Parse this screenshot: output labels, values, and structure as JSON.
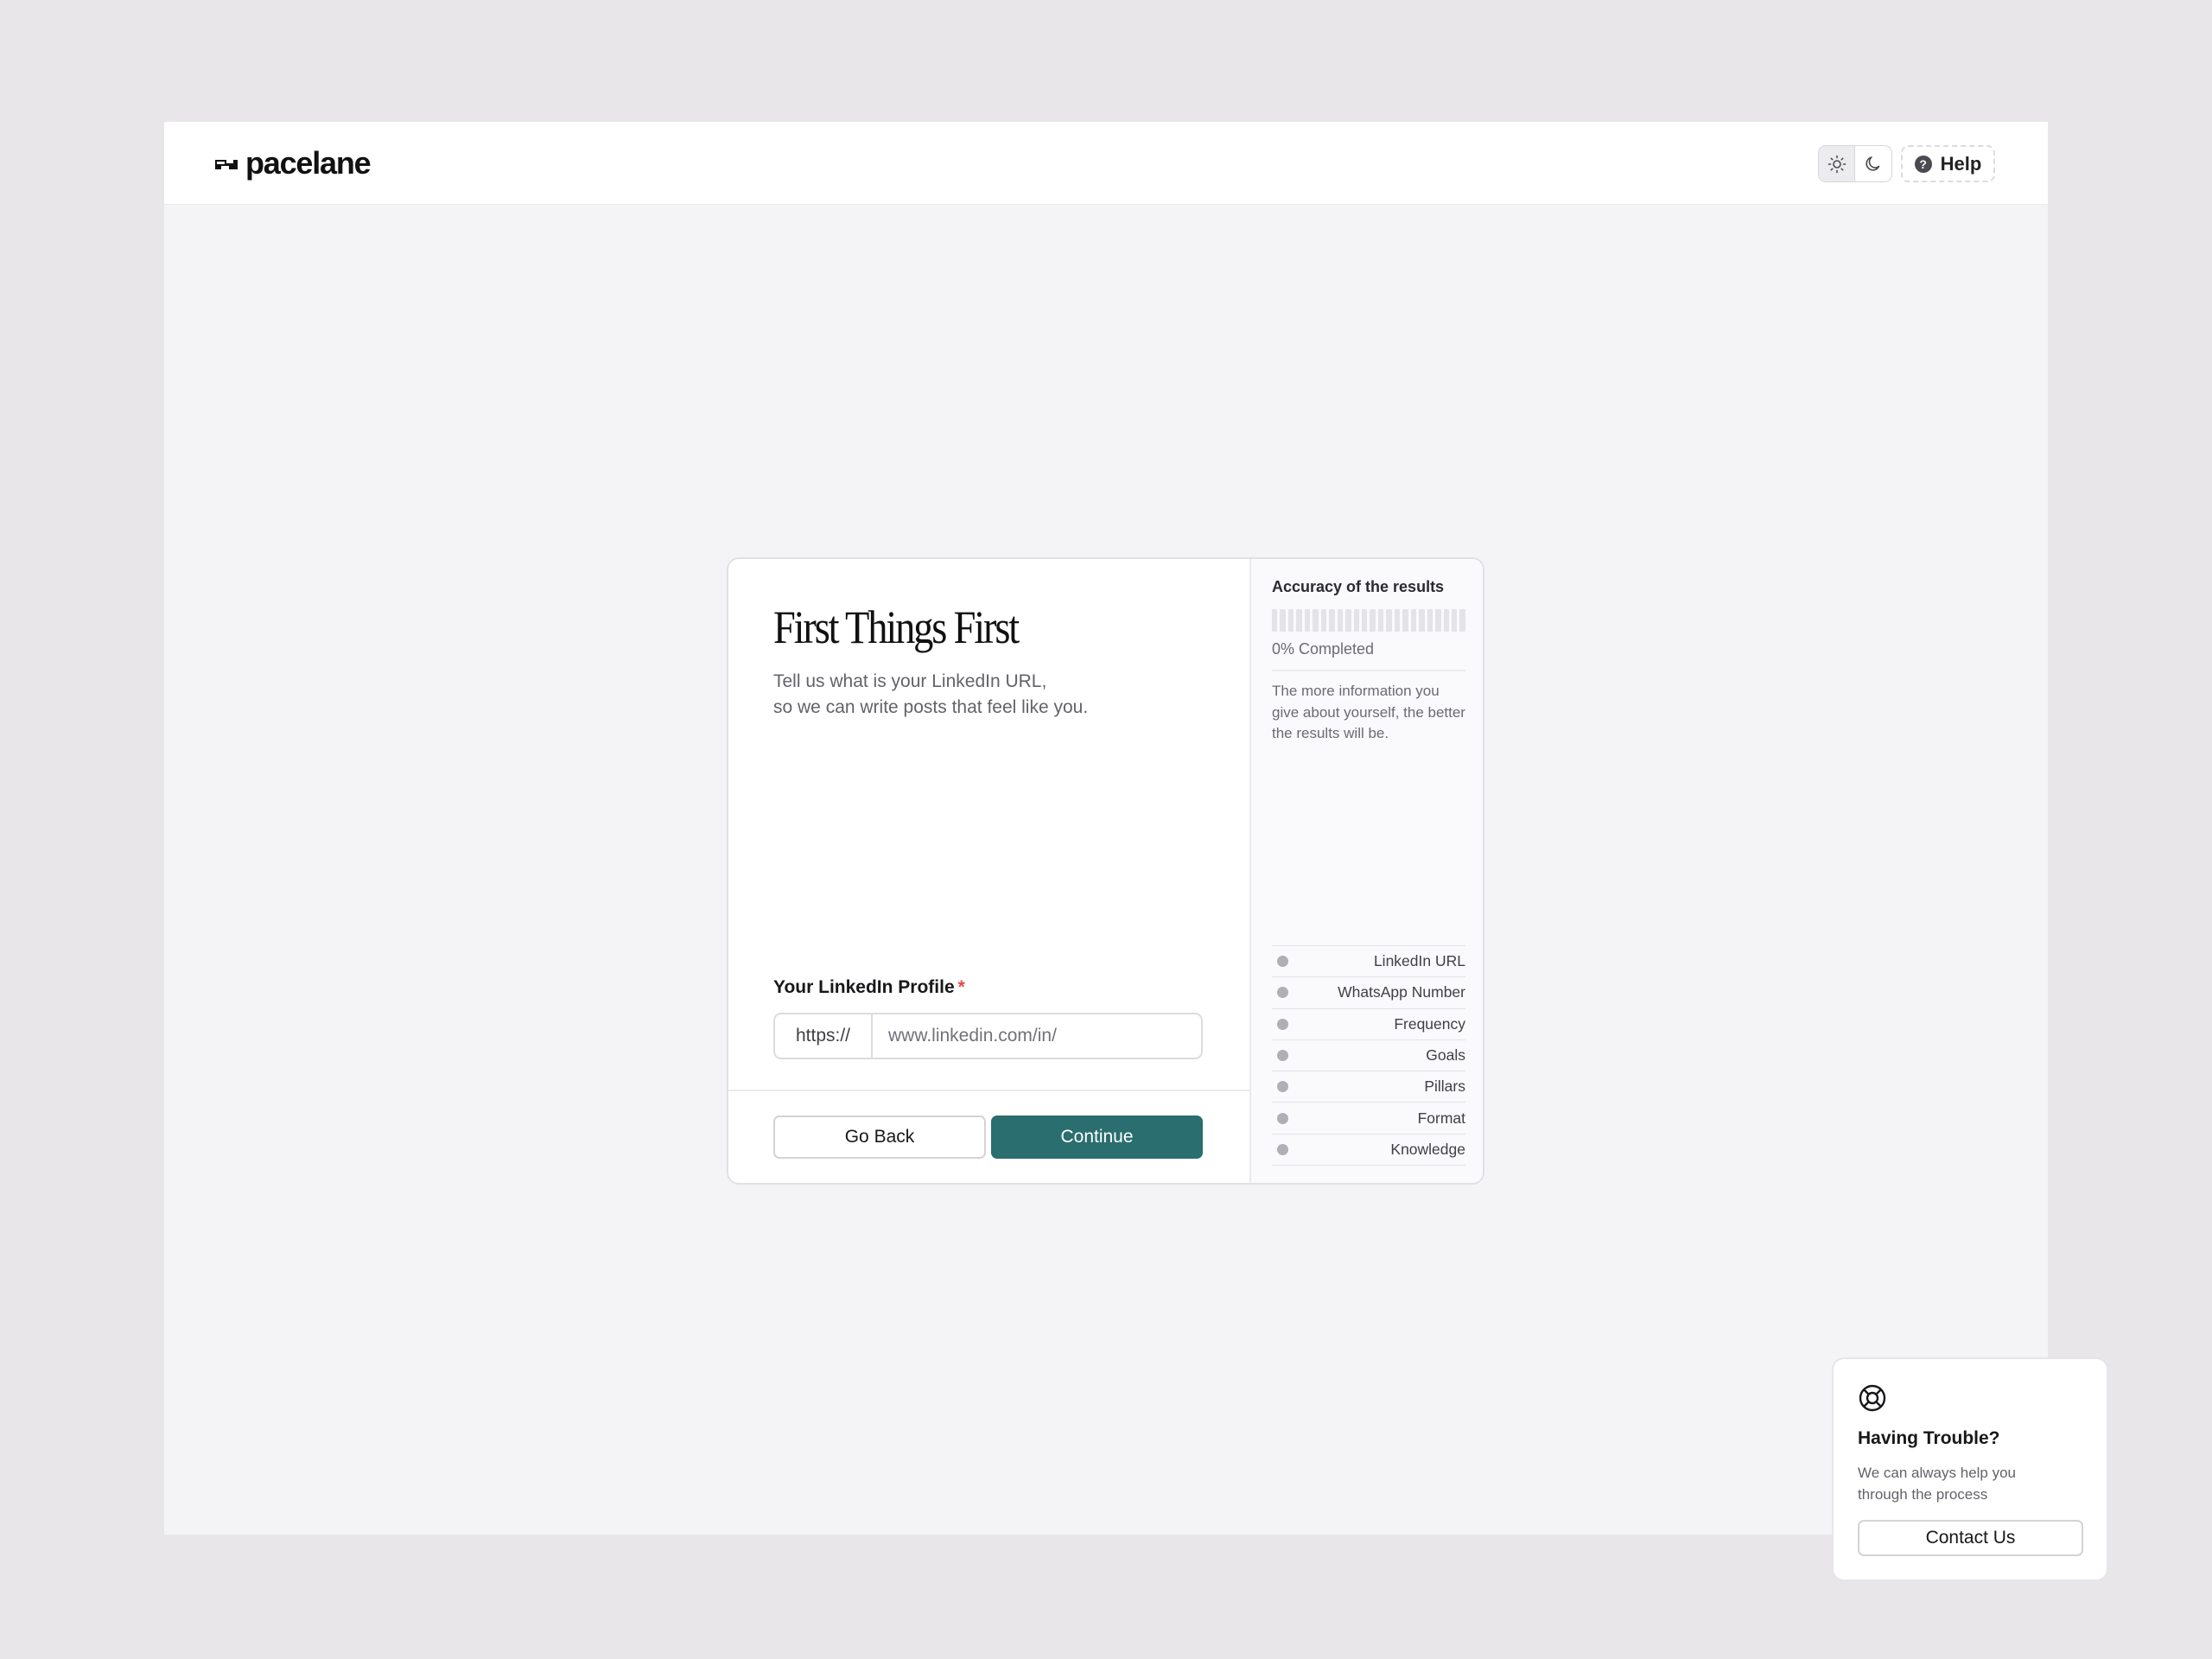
{
  "header": {
    "logo_text": "pacelane",
    "theme": {
      "light_icon": "sun-icon",
      "dark_icon": "moon-icon",
      "active": "light"
    },
    "help_label": "Help",
    "help_icon": "question-circle-icon"
  },
  "form": {
    "title": "First Things First",
    "subtitle_line1": "Tell us what is your LinkedIn URL,",
    "subtitle_line2": "so we can write posts that feel like you.",
    "field_label": "Your LinkedIn Profile",
    "required_marker": "*",
    "url_prefix": "https://",
    "url_placeholder": "www.linkedin.com/in/",
    "url_value": "",
    "back_label": "Go Back",
    "continue_label": "Continue"
  },
  "sidebar": {
    "title": "Accuracy of the results",
    "progress_fraction": 0,
    "progress_text": "0% Completed",
    "description": "The more information you give about yourself, the better the results will be.",
    "steps": [
      {
        "label": "LinkedIn URL"
      },
      {
        "label": "WhatsApp Number"
      },
      {
        "label": "Frequency"
      },
      {
        "label": "Goals"
      },
      {
        "label": "Pillars"
      },
      {
        "label": "Format"
      },
      {
        "label": "Knowledge"
      }
    ]
  },
  "help_card": {
    "icon": "lifebuoy-icon",
    "title": "Having Trouble?",
    "description": "We can always help you through the process",
    "button_label": "Contact Us"
  },
  "colors": {
    "accent": "#2a6e6f",
    "required": "#e5484d",
    "page_bg": "#e8e6e9",
    "app_bg": "#f4f3f6"
  }
}
